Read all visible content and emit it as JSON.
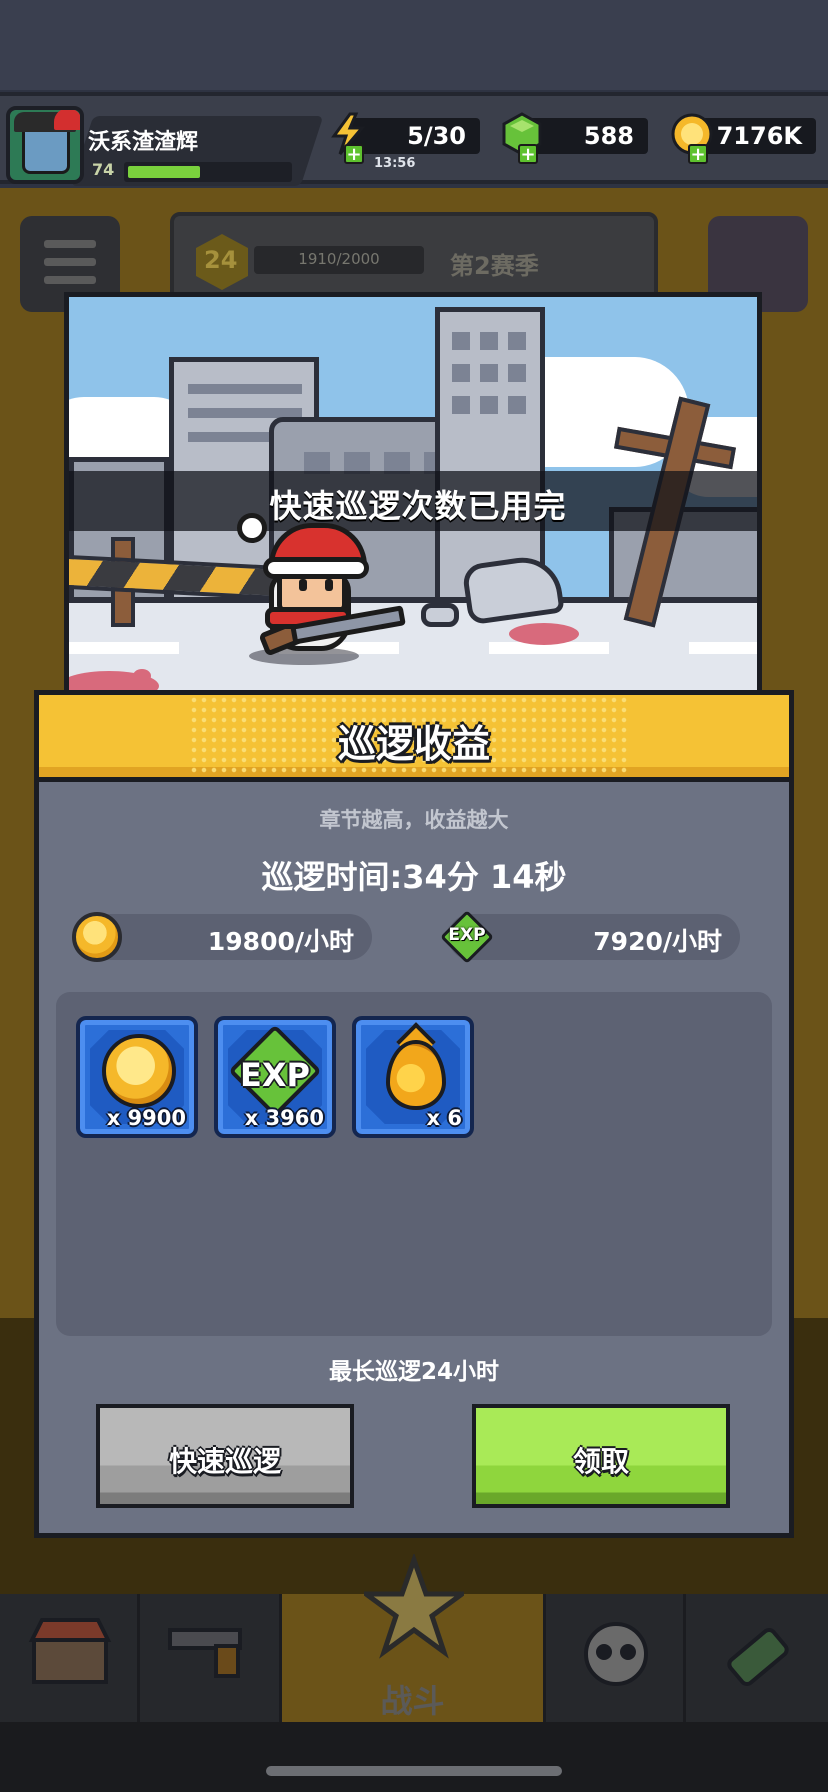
{
  "hud": {
    "player_name": "沃系渣渣辉",
    "player_level": "74",
    "xp_fraction": 0.45,
    "energy": "5/30",
    "energy_timer": "13:56",
    "gems": "588",
    "coins": "7176K"
  },
  "background": {
    "season_level": "24",
    "season_progress": "1910/2000",
    "season_label": "第2赛季",
    "battle_label": "战斗"
  },
  "scene": {
    "banner_text": "快速巡逻次数已用完"
  },
  "modal": {
    "title": "巡逻收益",
    "hint": "章节越高，收益越大",
    "patrol_time": "巡逻时间:34分 14秒",
    "coin_rate": "19800/小时",
    "exp_rate": "7920/小时",
    "exp_label": "EXP",
    "rewards": [
      {
        "icon": "gold-coin-icon",
        "qty": "x 9900"
      },
      {
        "icon": "exp-icon",
        "label": "EXP",
        "qty": "x 3960"
      },
      {
        "icon": "oil-drop-icon",
        "qty": "x 6"
      }
    ],
    "max_text": "最长巡逻24小时",
    "quick_patrol_label": "快速巡逻",
    "claim_label": "领取"
  },
  "colors": {
    "title_yellow": "#f5c235",
    "panel_gray": "#6c7283",
    "claim_green": "#8fd63d",
    "quick_gray": "#b0b0b0",
    "reward_blue": "#2c6fd8"
  }
}
